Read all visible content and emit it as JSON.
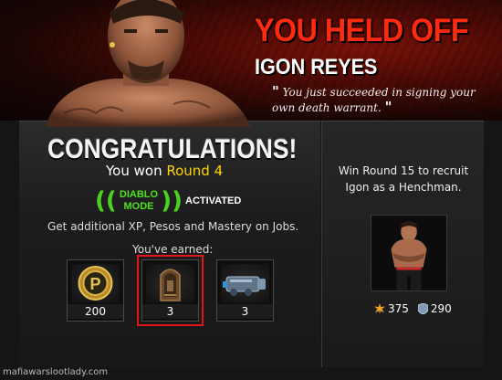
{
  "banner": {
    "headline": "YOU HELD OFF",
    "enemy_name": "IGON REYES",
    "quote_open": "\"",
    "quote_text": "You just succeeded in signing your own death warrant.",
    "quote_close": "\""
  },
  "result": {
    "congrats": "CONGRATULATIONS!",
    "won_prefix": "You won",
    "round": "Round 4",
    "mode_line1": "DIABLO",
    "mode_line2": "MODE",
    "mode_status": "ACTIVATED",
    "bonus_text": "Get additional XP, Pesos and Mastery on Jobs.",
    "earned_label": "You've earned:"
  },
  "rewards": [
    {
      "icon": "pesos-coin-icon",
      "count": "200"
    },
    {
      "icon": "plaque-item-icon",
      "count": "3"
    },
    {
      "icon": "cannon-part-icon",
      "count": "3"
    }
  ],
  "recruit": {
    "text": "Win Round 15 to recruit Igon as a Henchman.",
    "attack": "375",
    "defense": "290"
  },
  "watermark": "mafiawarslootlady.com",
  "colors": {
    "headline": "#ff2a10",
    "round_highlight": "#ffd500",
    "diablo_green": "#4fe01e",
    "selection_outline": "#e3151a"
  }
}
